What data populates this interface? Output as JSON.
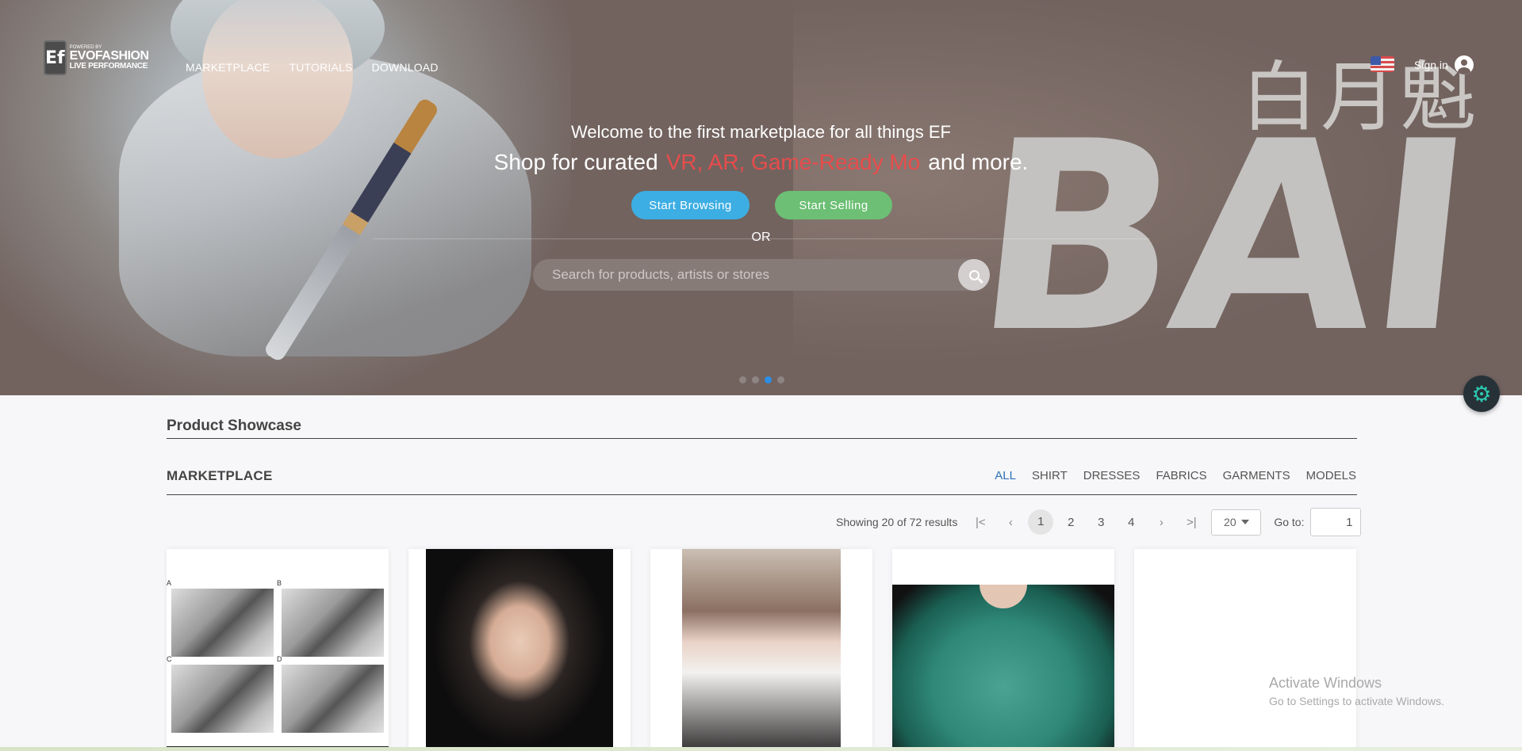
{
  "brand": {
    "logo_mark": "Ef",
    "logo_line1": "POWERED BY",
    "logo_line2": "EVOFASHION",
    "logo_line3": "LIVE PERFORMANCE"
  },
  "nav": {
    "items": [
      "MARKETPLACE",
      "TUTORIALS",
      "DOWNLOAD"
    ],
    "sign_in": "Sign in"
  },
  "hero": {
    "banner_text": "BAI",
    "banner_cjk": "白月魁",
    "welcome": "Welcome to the first marketplace for all things EF",
    "tagline_prefix": "Shop for curated",
    "tagline_highlight": "VR, AR, Game-Ready Mo",
    "tagline_suffix": "and more.",
    "browse_label": "Start Browsing",
    "sell_label": "Start Selling",
    "or_label": "OR",
    "search_placeholder": "Search for products, artists or stores",
    "slides": 4,
    "active_slide": 3
  },
  "showcase": {
    "title": "Product Showcase",
    "marketplace_title": "MARKETPLACE",
    "filters": [
      "ALL",
      "SHIRT",
      "DRESSES",
      "FABRICS",
      "GARMENTS",
      "MODELS"
    ],
    "active_filter": "ALL"
  },
  "pagination": {
    "results_text": "Showing 20 of 72 results",
    "pages": [
      "1",
      "2",
      "3",
      "4"
    ],
    "current_page": "1",
    "per_page": "20",
    "goto_label": "Go to:",
    "goto_value": "1"
  },
  "cards": {
    "panel_letters": [
      "A",
      "B",
      "C",
      "D"
    ]
  },
  "watermark": {
    "line1": "Activate Windows",
    "line2": "Go to Settings to activate Windows."
  },
  "colors": {
    "hero_bg": "#72635f",
    "browse_button": "#3daee3",
    "sell_button": "#6cbf74",
    "highlight_red": "#e84c4c",
    "active_filter": "#2f72b7",
    "active_dot": "#2d8ee5"
  }
}
